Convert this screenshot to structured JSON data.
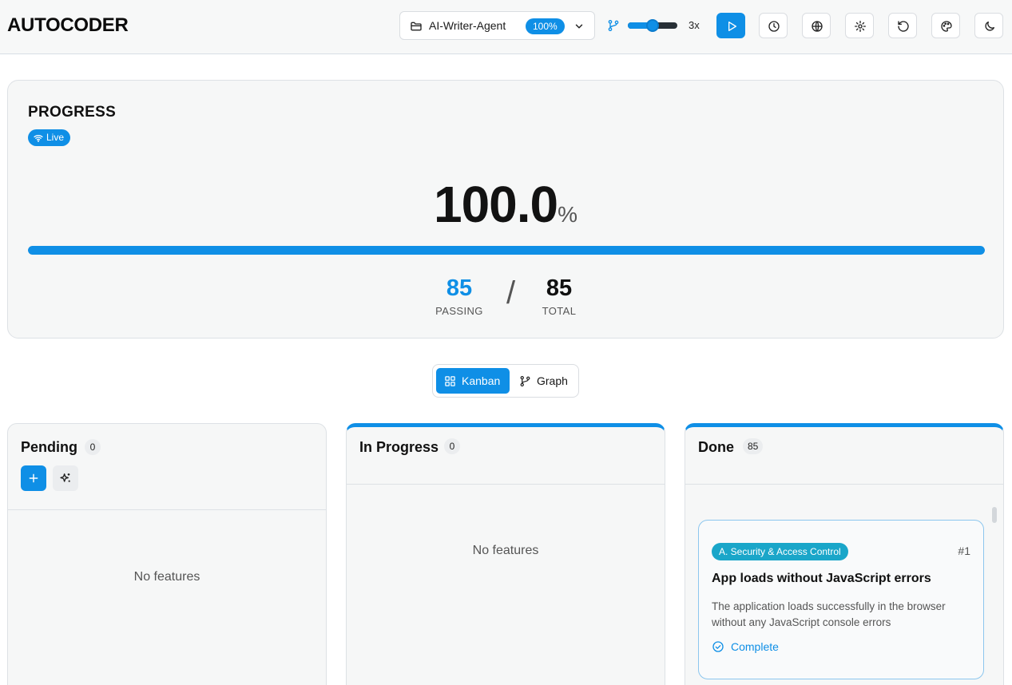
{
  "app": {
    "title": "AUTOCODER"
  },
  "header": {
    "project": {
      "name": "AI-Writer-Agent",
      "percent_badge": "100%"
    },
    "speed": {
      "label": "3x",
      "level": 0.5
    },
    "buttons": {
      "play": "play-icon",
      "history": "clock-icon",
      "web": "globe-icon",
      "settings": "gear-icon",
      "reset": "rotate-ccw-icon",
      "theme": "palette-icon",
      "dark_mode": "moon-icon"
    }
  },
  "progress": {
    "title": "PROGRESS",
    "live_label": "Live",
    "percent_value": "100.0",
    "percent_symbol": "%",
    "fraction": 1.0,
    "passing": {
      "value": "85",
      "label": "PASSING"
    },
    "separator": "/",
    "total": {
      "value": "85",
      "label": "TOTAL"
    }
  },
  "view_toggle": {
    "kanban_label": "Kanban",
    "graph_label": "Graph",
    "active": "kanban"
  },
  "columns": {
    "pending": {
      "title": "Pending",
      "count": "0",
      "empty_text": "No features"
    },
    "in_progress": {
      "title": "In Progress",
      "count": "0",
      "empty_text": "No features"
    },
    "done": {
      "title": "Done",
      "count": "85",
      "cards": [
        {
          "category": "A. Security & Access Control",
          "id": "#1",
          "title": "App loads without JavaScript errors",
          "description": "The application loads successfully in the browser without any JavaScript console errors",
          "status": "Complete"
        }
      ]
    }
  },
  "colors": {
    "accent": "#0f8fe6",
    "category_badge": "#1aa6c9",
    "card_border": "#8cc6ee"
  }
}
